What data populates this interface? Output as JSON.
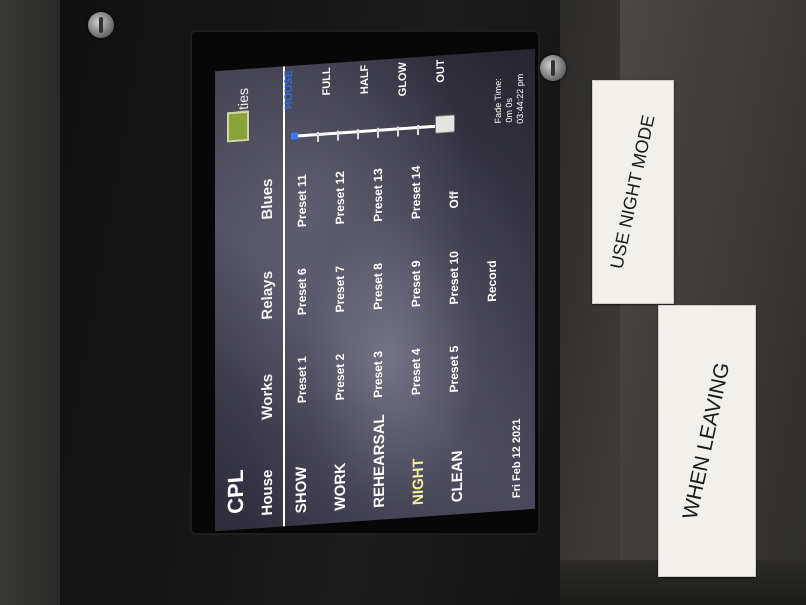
{
  "app": {
    "title": "CPL"
  },
  "tabs": [
    {
      "label": "House"
    },
    {
      "label": "Works"
    },
    {
      "label": "Relays"
    },
    {
      "label": "Blues"
    },
    {
      "label": "Utilities"
    }
  ],
  "scenes": [
    {
      "label": "SHOW"
    },
    {
      "label": "WORK"
    },
    {
      "label": "REHEARSAL"
    },
    {
      "label": "NIGHT"
    },
    {
      "label": "CLEAN"
    }
  ],
  "presets": [
    [
      "Preset 1",
      "Preset 6",
      "Preset 11"
    ],
    [
      "Preset 2",
      "Preset 7",
      "Preset 12"
    ],
    [
      "Preset 3",
      "Preset 8",
      "Preset 13"
    ],
    [
      "Preset 4",
      "Preset 9",
      "Preset 14"
    ],
    [
      "Preset 5",
      "Preset 10",
      "Off"
    ],
    [
      "",
      "Record",
      ""
    ]
  ],
  "fader": {
    "labels": [
      "HOUSE",
      "FULL",
      "HALF",
      "GLOW",
      "OUT"
    ],
    "level": 0.0
  },
  "status": {
    "fade_time": "Fade Time:",
    "fade_value": "0m 0s",
    "clock": "03:44:22 pm",
    "date": "Fri Feb 12 2021"
  },
  "labels": {
    "top": "USE NIGHT MODE",
    "bottom": "WHEN LEAVING"
  },
  "colors": {
    "active_scene": "#f3ef9a",
    "active_fader_label": "#2e6be0",
    "utility_indicator": "#8aa23a"
  }
}
